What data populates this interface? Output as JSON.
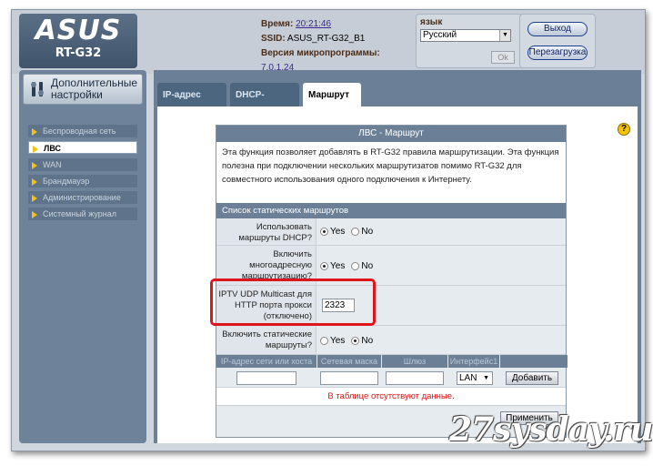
{
  "header": {
    "brand": "ASUS",
    "model": "RT-G32",
    "time_label": "Время:",
    "time_value": "20:21:46",
    "ssid_label": "SSID:",
    "ssid_value": "ASUS_RT-G32_B1",
    "firmware_label": "Версия микропрограммы:",
    "firmware_value": "7.0.1.24",
    "lang_label": "язык",
    "lang_value": "Русский",
    "ok_label": "Ok",
    "logout_label": "Выход",
    "reboot_label": "Перезагрузка"
  },
  "sidebar": {
    "title": "Дополнительные настройки",
    "items": [
      {
        "label": "Беспроводная сеть",
        "active": false
      },
      {
        "label": "ЛВС",
        "active": true
      },
      {
        "label": "WAN",
        "active": false
      },
      {
        "label": "Брандмауэр",
        "active": false
      },
      {
        "label": "Администрирование",
        "active": false
      },
      {
        "label": "Системный журнал",
        "active": false
      }
    ]
  },
  "tabs": [
    {
      "label": "IP-адрес ЛВС",
      "active": false
    },
    {
      "label": "DHCP-сервер",
      "active": false
    },
    {
      "label": "Маршрут",
      "active": true
    }
  ],
  "help_label": "?",
  "panel": {
    "title": "ЛВС - Маршрут",
    "description": "Эта функция позволяет добавлять в RT-G32 правила маршрутизации. Эта функция полезна при подключении нескольких маршрутизатов помимо RT-G32 для совместного использования одного подключения к Интернету.",
    "section_title": "Список статических маршрутов",
    "rows": {
      "dhcp_routes": {
        "label": "Использовать маршруты DHCP?",
        "yes": "Yes",
        "no": "No",
        "selected": "Yes"
      },
      "multicast_routing": {
        "label": "Включить многоадресную маршрутизацию?",
        "yes": "Yes",
        "no": "No",
        "selected": "Yes"
      },
      "iptv_udp": {
        "label": "IPTV UDP Multicast для HTTP порта прокси (отключено)",
        "value": "2323"
      },
      "static_routes": {
        "label": "Включить статические маршруты?",
        "yes": "Yes",
        "no": "No",
        "selected": "No"
      }
    },
    "table_columns": [
      "IP-адрес сети или хоста",
      "Сетевая маска",
      "Шлюз",
      "Интерфейс1"
    ],
    "interface_value": "LAN",
    "add_label": "Добавить",
    "empty_message": "В таблице отсутствуют данные.",
    "apply_label": "Применить"
  },
  "watermark": "27sysday.ru"
}
